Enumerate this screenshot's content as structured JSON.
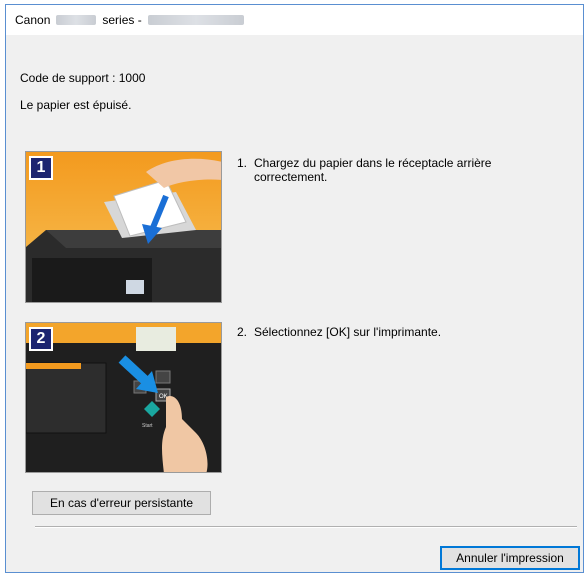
{
  "window": {
    "title_prefix": "Canon",
    "title_middle": "series -",
    "colors": {
      "frame": "#5a8fd1",
      "body": "#f0f0f0",
      "step_badge": "#1c2470"
    }
  },
  "message": {
    "support_code": "Code de support : 1000",
    "status": "Le papier est épuisé."
  },
  "steps": [
    {
      "badge": "1",
      "number": "1.",
      "text_line1": "Chargez du papier dans le réceptacle arrière",
      "text_line2": "correctement.",
      "image": "printer-load-paper-illustration"
    },
    {
      "badge": "2",
      "number": "2.",
      "text_line1": "Sélectionnez [OK] sur l'imprimante.",
      "image": "printer-panel-ok-illustration"
    }
  ],
  "illustration": {
    "panel_ok": "OK",
    "panel_start": "Start"
  },
  "buttons": {
    "persistent_error": "En cas d'erreur persistante",
    "cancel_print": "Annuler l'impression"
  }
}
